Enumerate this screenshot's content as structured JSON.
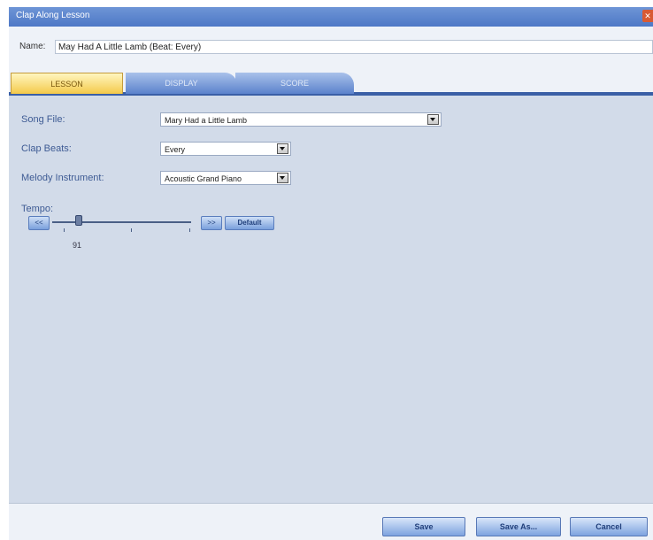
{
  "window": {
    "title": "Clap Along Lesson",
    "close_glyph": "✕"
  },
  "name_row": {
    "label": "Name:",
    "value": "May Had A Little Lamb (Beat: Every)"
  },
  "tabs": [
    {
      "label": "LESSON",
      "active": true
    },
    {
      "label": "DISPLAY",
      "active": false
    },
    {
      "label": "SCORE",
      "active": false
    }
  ],
  "fields": {
    "song_file": {
      "label": "Song File:",
      "value": "Mary Had a Little Lamb"
    },
    "clap_beats": {
      "label": "Clap Beats:",
      "value": "Every"
    },
    "melody_instrument": {
      "label": "Melody Instrument:",
      "value": "Acoustic Grand Piano"
    }
  },
  "tempo": {
    "label": "Tempo:",
    "slower_glyph": "<<",
    "faster_glyph": ">>",
    "default_label": "Default",
    "value": "91"
  },
  "footer": {
    "save": "Save",
    "save_as": "Save As...",
    "cancel": "Cancel"
  },
  "colors": {
    "accent": "#3a5fa6",
    "active_tab": "#f4c94a",
    "panel": "#d2dbe9"
  },
  "icons": [
    "close-icon",
    "dropdown-arrow-icon"
  ]
}
